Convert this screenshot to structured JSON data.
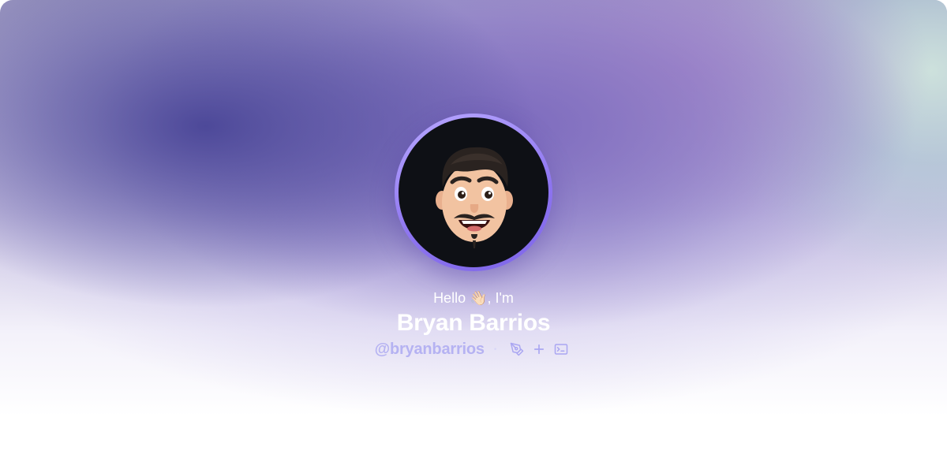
{
  "profile": {
    "greeting": "Hello 👋🏻, I'm",
    "name": "Bryan Barrios",
    "handle": "@bryanbarrios",
    "separator": "•",
    "avatar_alt": "Bryan Barrios memoji avatar",
    "icons": [
      "pen-nib-icon",
      "plus-icon",
      "terminal-icon"
    ]
  },
  "colors": {
    "accent": "#8d74f0",
    "handle": "#b5b2f2",
    "avatar_bg": "#0e1015"
  }
}
